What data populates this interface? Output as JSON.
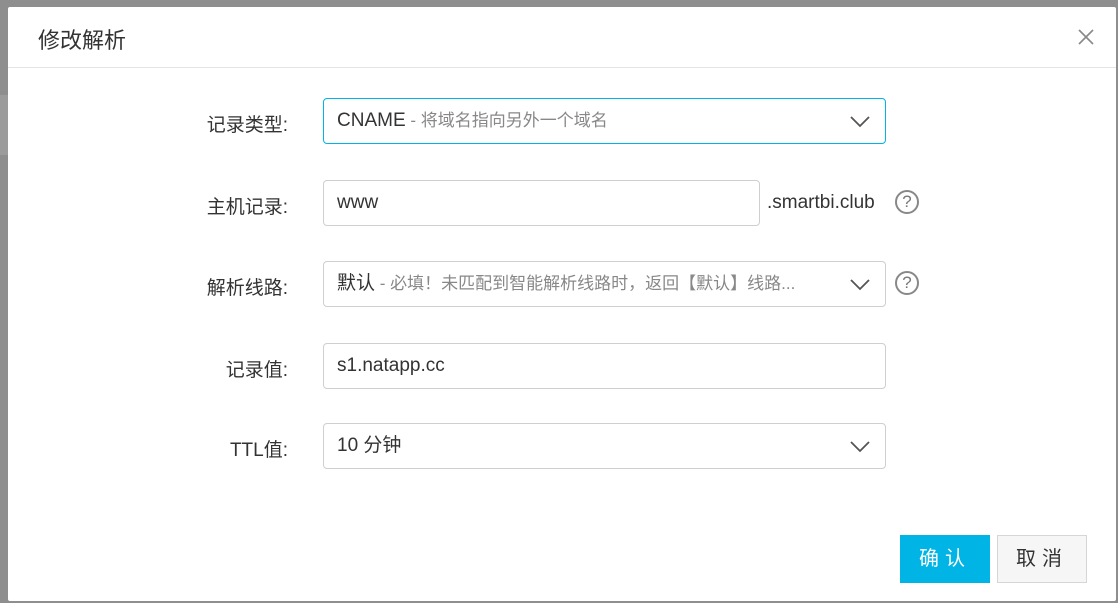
{
  "dialog": {
    "title": "修改解析",
    "close_icon": "close-icon"
  },
  "form": {
    "record_type": {
      "label": "记录类型:",
      "value": "CNAME",
      "hint": " - 将域名指向另外一个域名"
    },
    "host_record": {
      "label": "主机记录:",
      "value": "www",
      "suffix": ".smartbi.club",
      "help": "?"
    },
    "line": {
      "label": "解析线路:",
      "value": "默认",
      "hint": " - 必填！未匹配到智能解析线路时，返回【默认】线路...",
      "help": "?"
    },
    "record_value": {
      "label": "记录值:",
      "value": "s1.natapp.cc"
    },
    "ttl": {
      "label": "TTL值:",
      "value": "10 分钟"
    }
  },
  "footer": {
    "confirm_label": "确认",
    "cancel_label": "取消"
  },
  "colors": {
    "accent": "#00b4e6"
  }
}
